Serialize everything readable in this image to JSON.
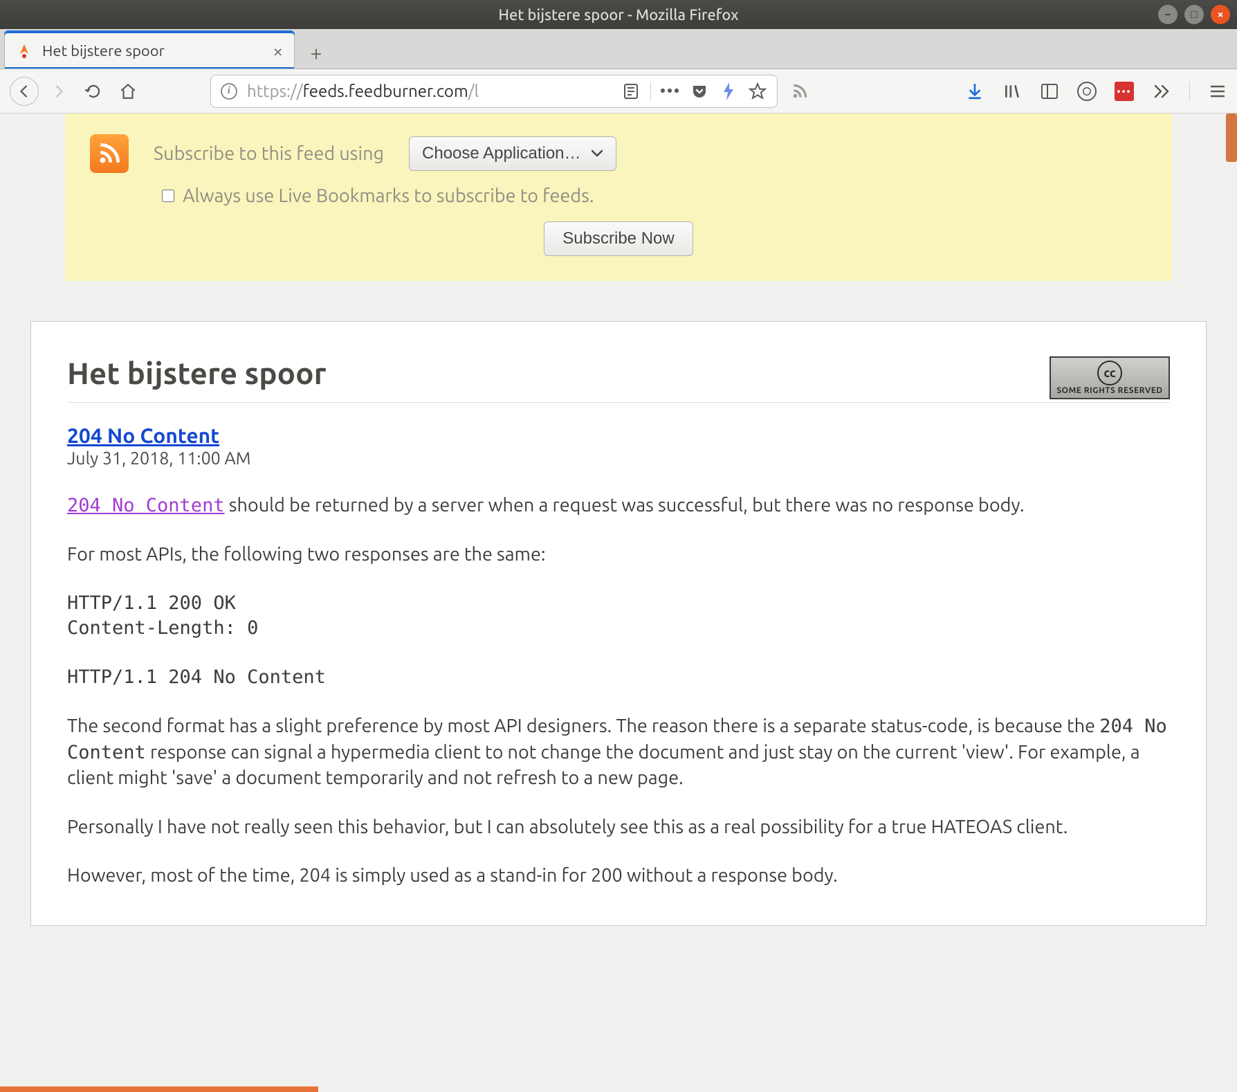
{
  "window": {
    "title": "Het bijstere spoor - Mozilla Firefox"
  },
  "tab": {
    "title": "Het bijstere spoor"
  },
  "urlbar": {
    "protocol": "https://",
    "domain": "feeds.feedburner.com",
    "path": "/l"
  },
  "feedbox": {
    "subscribe_label": "Subscribe to this feed using",
    "choose_app": "Choose Application…",
    "always_use": "Always use Live Bookmarks to subscribe to feeds.",
    "subscribe_now": "Subscribe Now"
  },
  "feed": {
    "title": "Het bijstere spoor",
    "cc_label": "SOME RIGHTS RESERVED",
    "entry": {
      "title": "204 No Content",
      "date": "July 31, 2018, 11:00 AM",
      "inline_link": "204 No Content",
      "p1_rest": " should be returned by a server when a request was successful, but there was no response body.",
      "p2": "For most APIs, the following two responses are the same:",
      "pre1_line1": "HTTP/1.1 200 OK",
      "pre1_line2": "Content-Length: 0",
      "pre2": "HTTP/1.1 204 No Content",
      "p3_a": "The second format has a slight preference by most API designers. The reason there is a separate status-code, is because the ",
      "p3_code": "204 No Content",
      "p3_b": " response can signal a hypermedia client to not change the document and just stay on the current 'view'. For example, a client might 'save' a document temporarily and not refresh to a new page.",
      "p4": "Personally I have not really seen this behavior, but I can absolutely see this as a real possibility for a true HATEOAS client.",
      "p5": "However, most of the time, 204 is simply used as a stand-in for 200 without a response body."
    }
  }
}
